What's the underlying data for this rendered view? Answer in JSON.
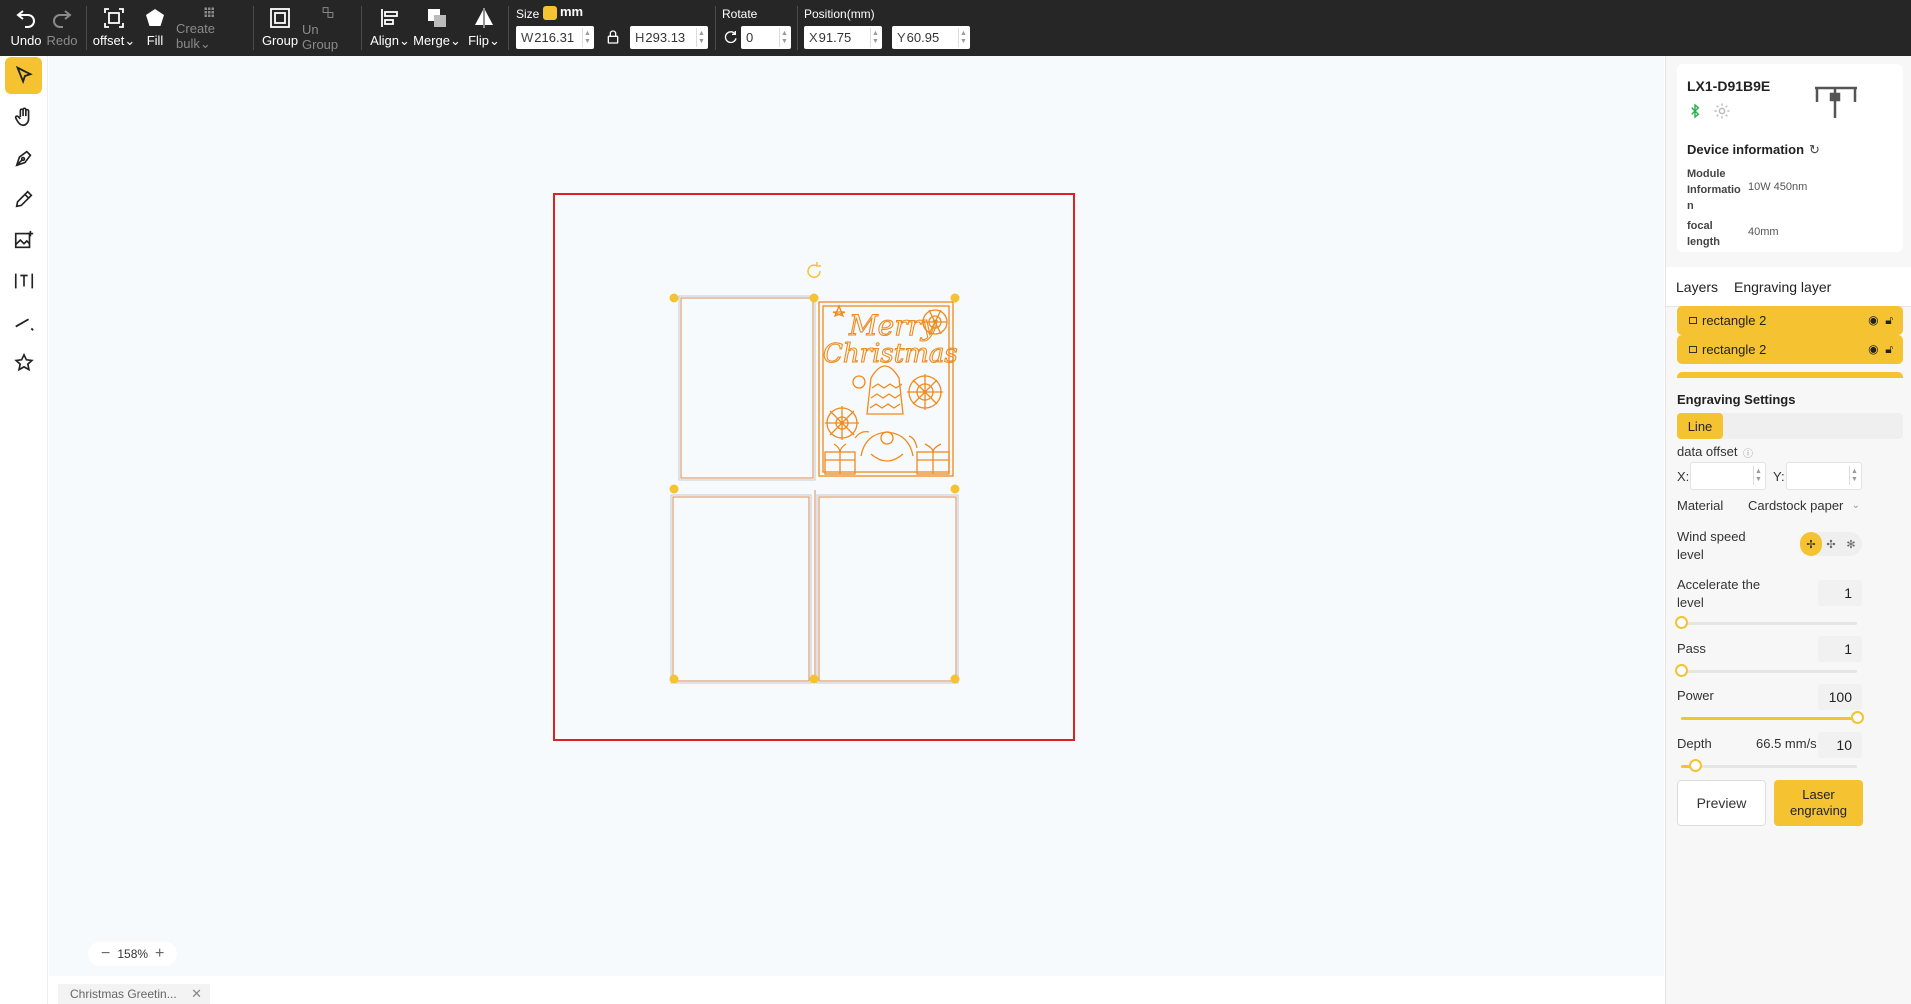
{
  "toolbar": {
    "undo": "Undo",
    "redo": "Redo",
    "offset": "offset",
    "fill": "Fill",
    "create_bulk": "Create bulk",
    "group": "Group",
    "ungroup": "Un Group",
    "align": "Align",
    "merge": "Merge",
    "flip": "Flip",
    "size_label": "Size",
    "unit": "mm",
    "width_prefix": "W",
    "width": "216.31",
    "height_prefix": "H",
    "height": "293.13",
    "rotate_label": "Rotate",
    "rotate": "0",
    "position_label": "Position(mm)",
    "x_prefix": "X",
    "x": "91.75",
    "y_prefix": "Y",
    "y": "60.95"
  },
  "tools": [
    "select-tool",
    "hand-tool",
    "pen-tool",
    "pencil-tool",
    "image-tool",
    "text-tool",
    "line-tool",
    "shape-tool"
  ],
  "canvas": {
    "zoom": "158%",
    "card_text_line1": "Merry",
    "card_text_line2": "Christmas",
    "accent_color": "#f08a1c",
    "work_area_color": "#e02020"
  },
  "file_tab": {
    "name": "Christmas Greetin..."
  },
  "device": {
    "name": "LX1-D91B9E",
    "info_title": "Device information",
    "module_label": "Module Informatio n",
    "module_value": "10W 450nm",
    "focal_label": "focal length",
    "focal_value": "40mm"
  },
  "tabs": {
    "layers": "Layers",
    "engraving_layer": "Engraving layer"
  },
  "layers": [
    {
      "name": "rectangle 2"
    },
    {
      "name": "rectangle 2"
    }
  ],
  "settings": {
    "title": "Engraving Settings",
    "mode": "Line",
    "data_offset": "data offset",
    "x_label": "X:",
    "y_label": "Y:",
    "material_label": "Material",
    "material_value": "Cardstock paper",
    "wind_label": "Wind speed level",
    "accel_label": "Accelerate the level",
    "accel_value": "1",
    "pass_label": "Pass",
    "pass_value": "1",
    "power_label": "Power",
    "power_value": "100",
    "depth_label": "Depth",
    "depth_speed": "66.5 mm/s",
    "depth_value": "10",
    "accel_level": 0,
    "pass_level": 0,
    "power_level": 1.0,
    "depth_level": 0.08
  },
  "actions": {
    "preview": "Preview",
    "laser": "Laser engraving"
  },
  "colors": {
    "accent": "#f5c331",
    "toolbar_bg": "#262626"
  }
}
